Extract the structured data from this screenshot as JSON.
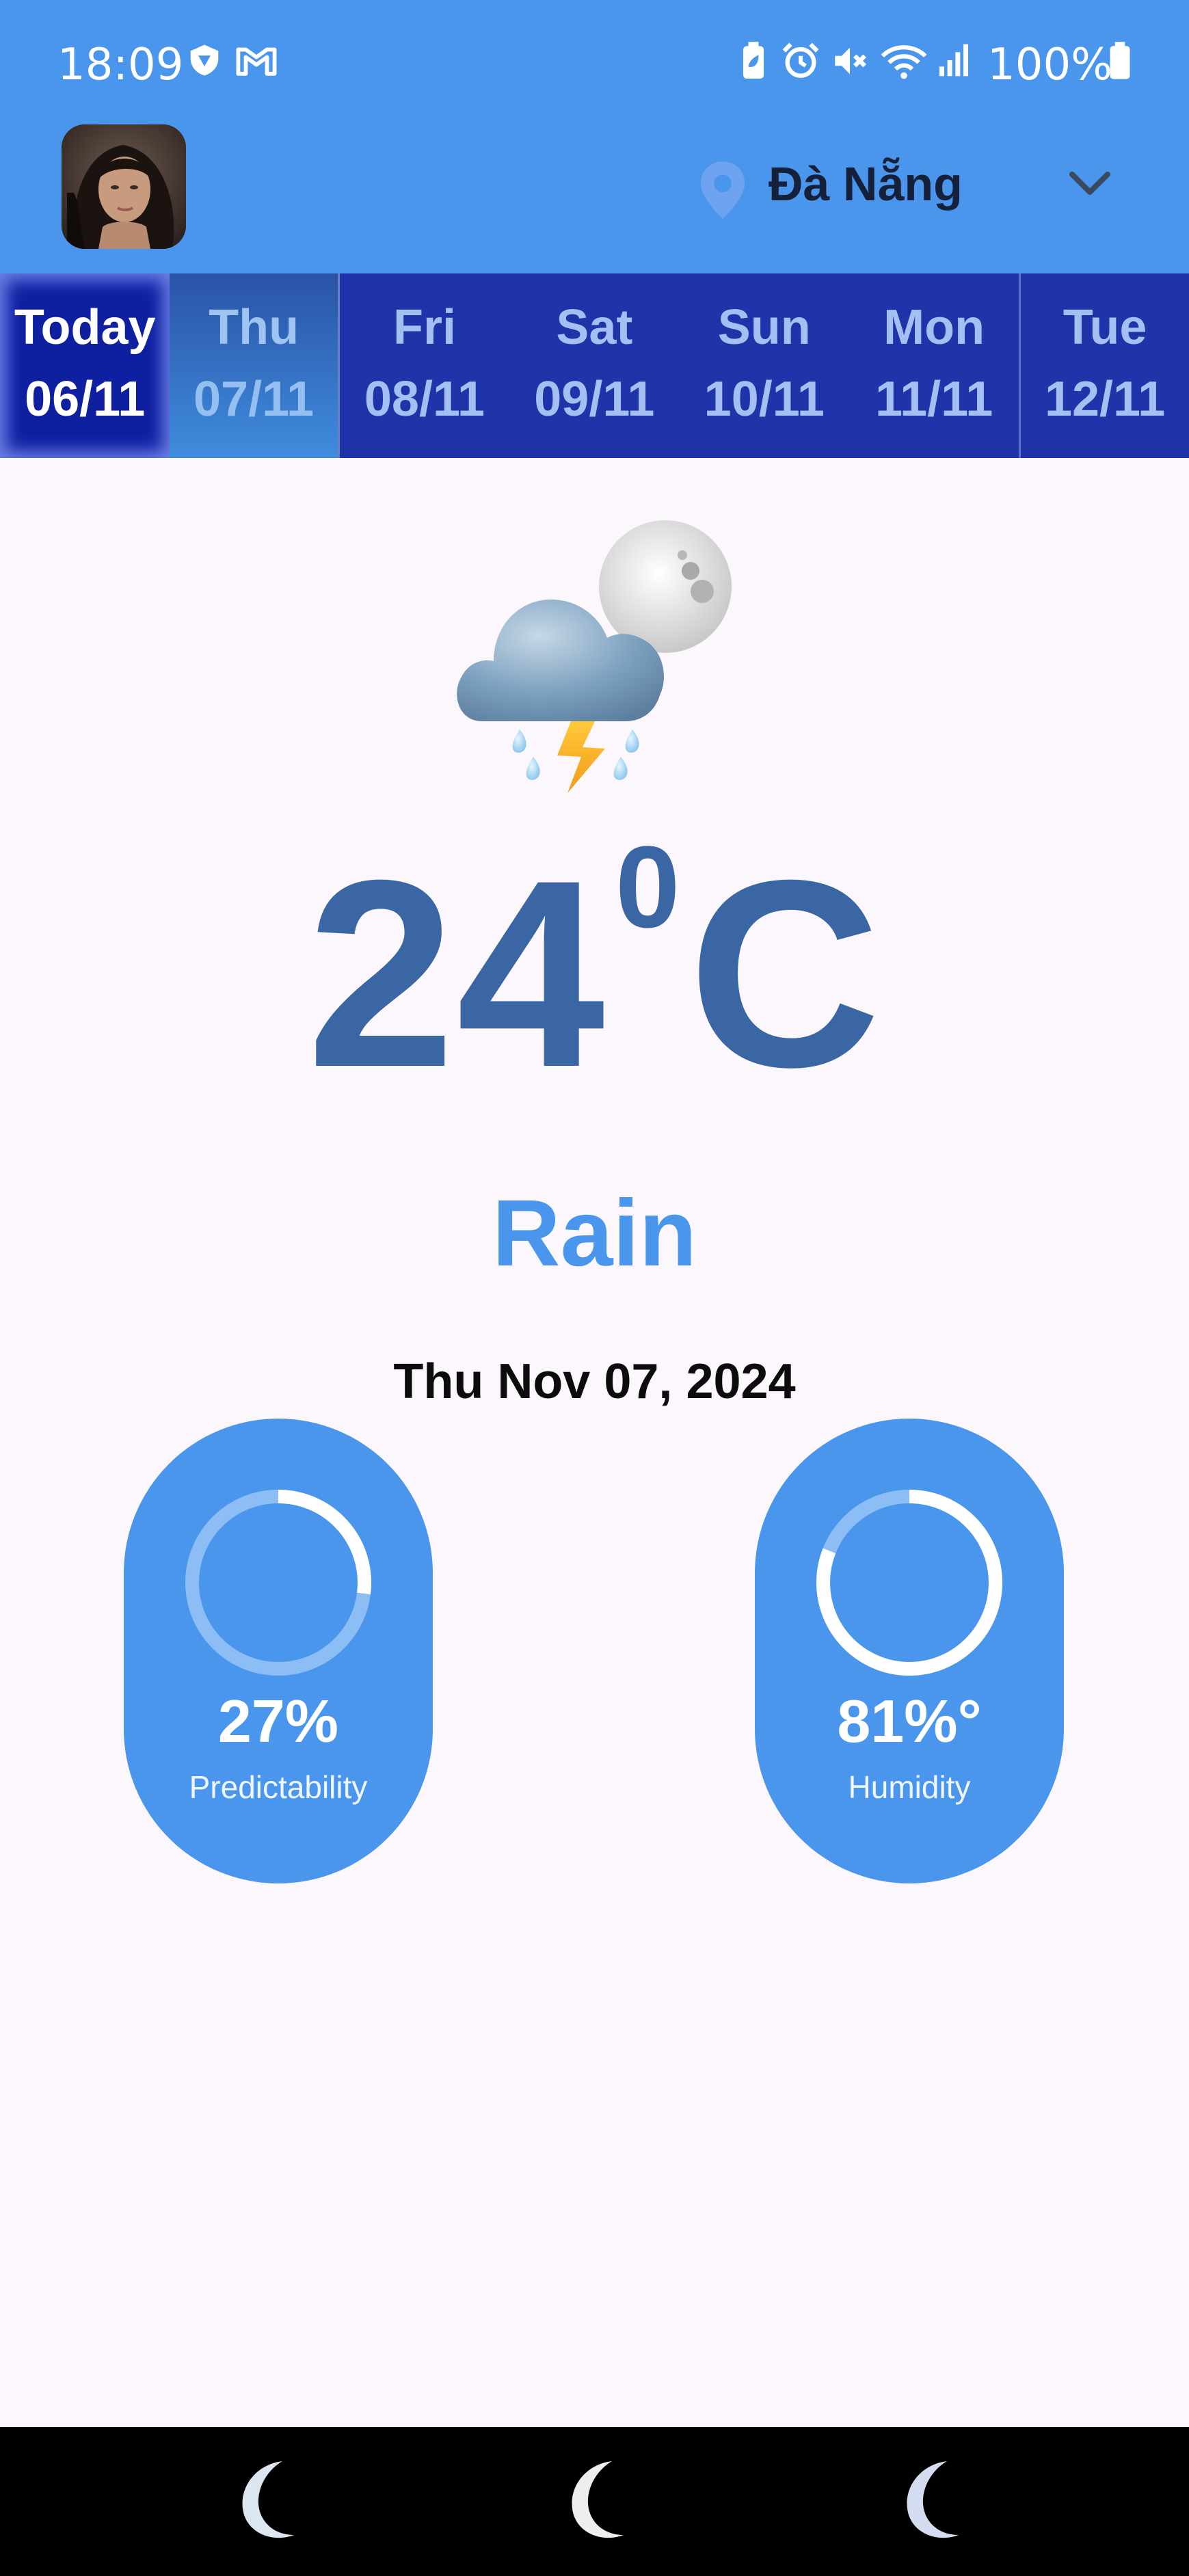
{
  "status_bar": {
    "time": "18:09",
    "battery": "100%",
    "left_icons": [
      "shield-icon",
      "gmail-icon"
    ],
    "right_icons": [
      "battery-saver-icon",
      "alarm-icon",
      "mute-icon",
      "wifi-icon",
      "signal-icon",
      "battery-icon"
    ]
  },
  "header": {
    "avatar": "profile-avatar",
    "location": "Đà Nẵng"
  },
  "tabs": [
    {
      "day": "Today",
      "date": "06/11",
      "state": "today"
    },
    {
      "day": "Thu",
      "date": "07/11",
      "state": "selected"
    },
    {
      "day": "Fri",
      "date": "08/11",
      "state": ""
    },
    {
      "day": "Sat",
      "date": "09/11",
      "state": ""
    },
    {
      "day": "Sun",
      "date": "10/11",
      "state": ""
    },
    {
      "day": "Mon",
      "date": "11/11",
      "state": ""
    },
    {
      "day": "Tue",
      "date": "12/11",
      "state": ""
    }
  ],
  "weather": {
    "icon": "thunderstorm-night-icon",
    "temperature": "24",
    "degree_mark": "0",
    "unit": "C",
    "condition": "Rain",
    "date": "Thu Nov 07, 2024"
  },
  "stats": {
    "predictability": {
      "value": "27%",
      "label": "Predictability",
      "fraction": 0.27
    },
    "humidity": {
      "value": "81%°",
      "label": "Humidity",
      "fraction": 0.81
    }
  },
  "colors": {
    "primary": "#4a96ec",
    "tab_bar": "#1f34a8",
    "temperature": "#3b66a4"
  }
}
